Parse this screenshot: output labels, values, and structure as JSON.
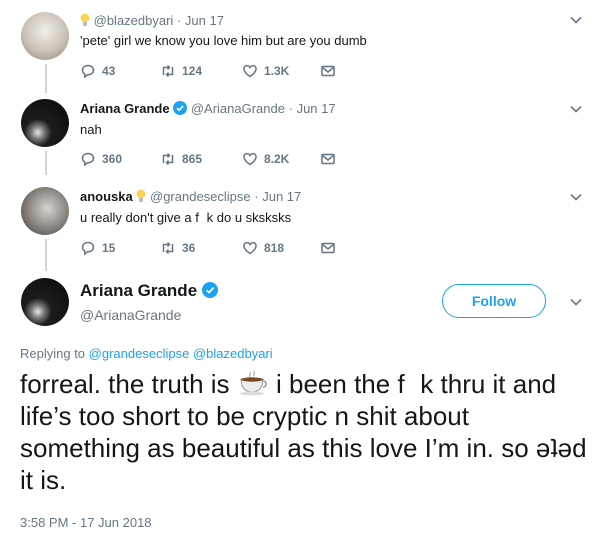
{
  "tweets": [
    {
      "handle": "@blazedbyari",
      "date": "Jun 17",
      "text": "'pete' girl we know you love him but are you dumb",
      "replies": "43",
      "retweets": "124",
      "likes": "1.3K"
    },
    {
      "name": "Ariana Grande",
      "handle": "@ArianaGrande",
      "date": "Jun 17",
      "text": "nah",
      "replies": "360",
      "retweets": "865",
      "likes": "8.2K"
    },
    {
      "name": "anouska",
      "handle": "@grandeseclipse",
      "date": "Jun 17",
      "text": "u really don't give a f   k do u sksksks",
      "replies": "15",
      "retweets": "36",
      "likes": "818"
    }
  ],
  "main": {
    "name": "Ariana Grande",
    "handle": "@ArianaGrande",
    "follow_label": "Follow",
    "replying_prefix": "Replying to",
    "replying_to_1": "@grandeseclipse",
    "replying_to_2": "@blazedbyari",
    "text_before_emoji": "forreal. the truth is",
    "text_after_emoji": "i been the f   k thru it and life’s too short to be cryptic n shit about something as beautiful as this love I’m in. so ǝʇǝd it is.",
    "timestamp": "3:58 PM - 17 Jun 2018"
  },
  "colors": {
    "accent": "#1da1f2",
    "secondary_text": "#657786",
    "thread_line": "#ccd6dd"
  }
}
